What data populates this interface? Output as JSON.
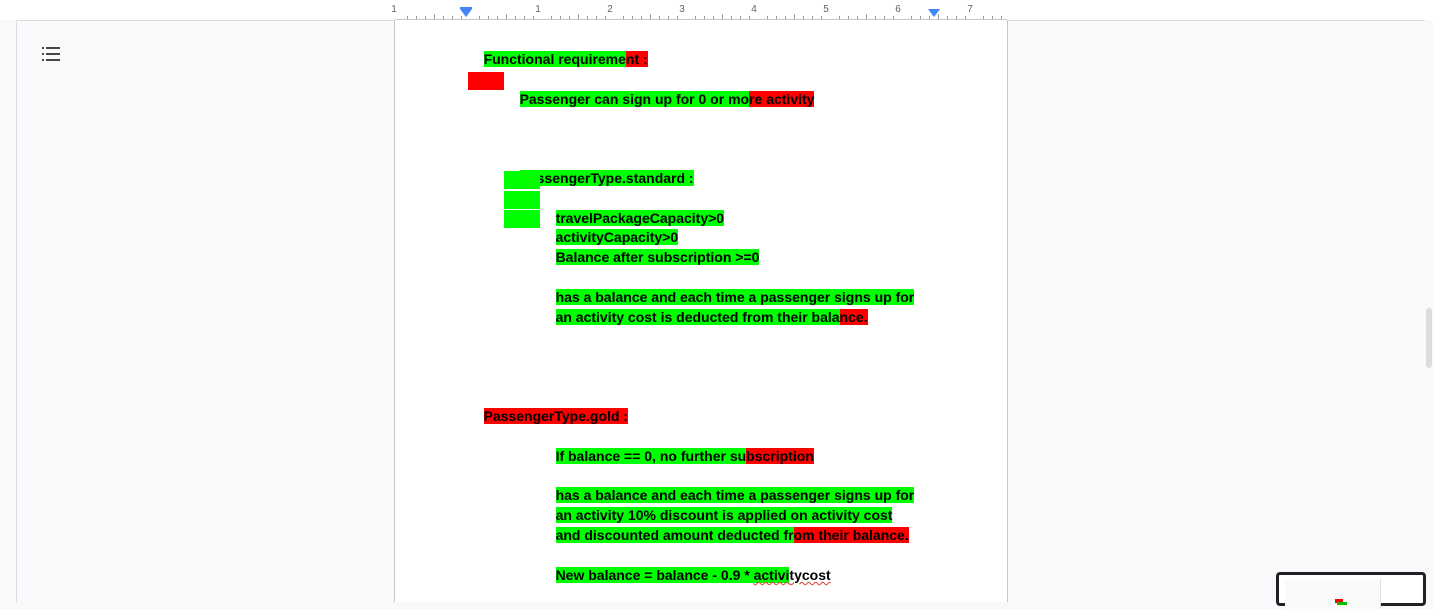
{
  "ruler": {
    "numbers": [
      "1",
      "1",
      "2",
      "3",
      "4",
      "5",
      "6",
      "7"
    ]
  },
  "outline": {
    "icon": "list-icon"
  },
  "doc": {
    "line1_a": "Functional requireme",
    "line1_b": "nt :",
    "line2_a": "Passenger can sign up for 0 or mo",
    "line2_b": "re activity",
    "line3": "PassengerType.standard :",
    "line4": "travelPackageCapacity>0",
    "line5": "activityCapacity>0",
    "line6": "Balance after subscription >=0",
    "line7": "has a balance and each time a passenger signs up for",
    "line8_a": "an activity cost is deducted from their bala",
    "line8_b": "nce.",
    "line9": "PassengerType.gold :",
    "line10_a": "If balance == 0, no further su",
    "line10_b": "bscription",
    "line11": "has a balance and each time a passenger signs up for",
    "line12": "an activity 10% discount is applied on activity cost",
    "line13_a": "and discounted amount deducted fr",
    "line13_b": "om their balance.",
    "line14_a": "New balance = balance - 0.9 * ",
    "line14_b": "activi",
    "line14_c": "tycost"
  },
  "colors": {
    "highlight_green": "#00ff00",
    "highlight_red": "#ff0000",
    "accent": "#4285f4"
  }
}
